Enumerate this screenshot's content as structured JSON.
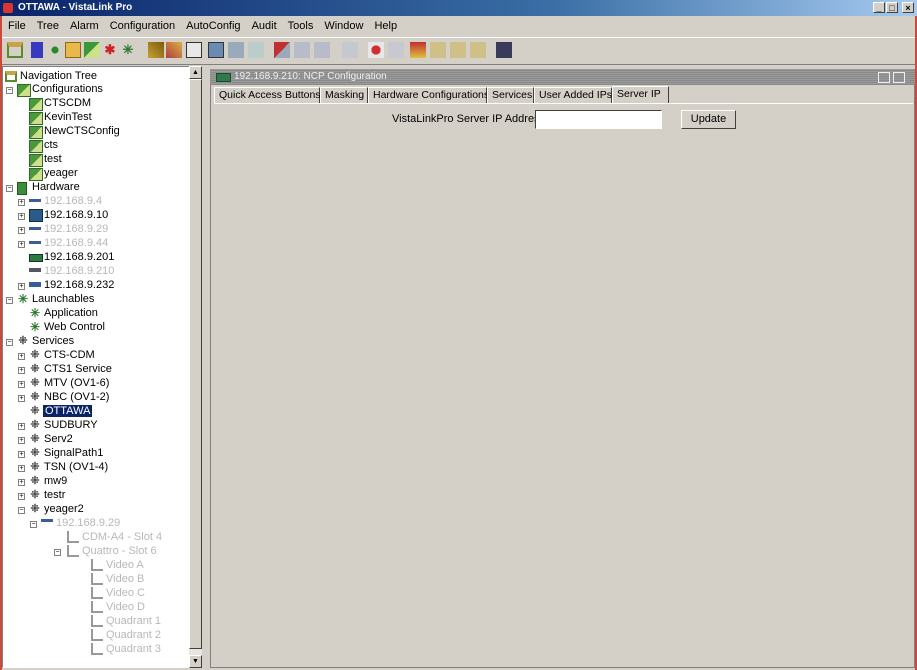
{
  "window": {
    "title": "OTTAWA - VistaLink Pro",
    "caption_buttons": [
      "_",
      "□",
      "×"
    ]
  },
  "menu": [
    "File",
    "Tree",
    "Alarm",
    "Configuration",
    "AutoConfig",
    "Audit",
    "Tools",
    "Window",
    "Help"
  ],
  "nav": {
    "title": "Navigation Tree",
    "configurations": {
      "label": "Configurations",
      "items": [
        "CTSCDM",
        "KevinTest",
        "NewCTSConfig",
        "cts",
        "test",
        "yeager"
      ]
    },
    "hardware": {
      "label": "Hardware",
      "items": [
        {
          "label": "192.168.9.4",
          "inactive": true
        },
        {
          "label": "192.168.9.10",
          "inactive": false
        },
        {
          "label": "192.168.9.29",
          "inactive": true
        },
        {
          "label": "192.168.9.44",
          "inactive": true
        },
        {
          "label": "192.168.9.201",
          "inactive": false
        },
        {
          "label": "192.168.9.210",
          "inactive": true
        },
        {
          "label": "192.168.9.232",
          "inactive": false
        }
      ]
    },
    "launchables": {
      "label": "Launchables",
      "items": [
        "Application",
        "Web Control"
      ]
    },
    "services": {
      "label": "Services",
      "items": [
        "CTS-CDM",
        "CTS1 Service",
        "MTV (OV1-6)",
        "NBC (OV1-2)",
        "OTTAWA",
        "SUDBURY",
        "Serv2",
        "SignalPath1",
        "TSN (OV1-4)",
        "mw9",
        "testr",
        "yeager2"
      ]
    },
    "yeager2_children": {
      "device": "192.168.9.29",
      "slots": [
        "CDM-A4 - Slot 4",
        "Quattro - Slot 6"
      ],
      "quattro_children": [
        "Video A",
        "Video B",
        "Video C",
        "Video D",
        "Quadrant 1",
        "Quadrant 2",
        "Quadrant 3"
      ]
    },
    "selected": "OTTAWA"
  },
  "frame": {
    "title": "192.168.9.210: NCP Configuration"
  },
  "tabs": [
    "Quick Access Buttons",
    "Masking",
    "Hardware Configurations",
    "Services",
    "User Added IPs",
    "Server IP"
  ],
  "active_tab": "Server IP",
  "form": {
    "label": "VistaLinkPro Server IP Address",
    "value": "",
    "button": "Update"
  },
  "colors": {
    "title_start": "#0a246a",
    "title_end": "#a6caf0",
    "window_border": "#c94a3a",
    "face": "#d4d0c8",
    "selection": "#0a246a"
  }
}
